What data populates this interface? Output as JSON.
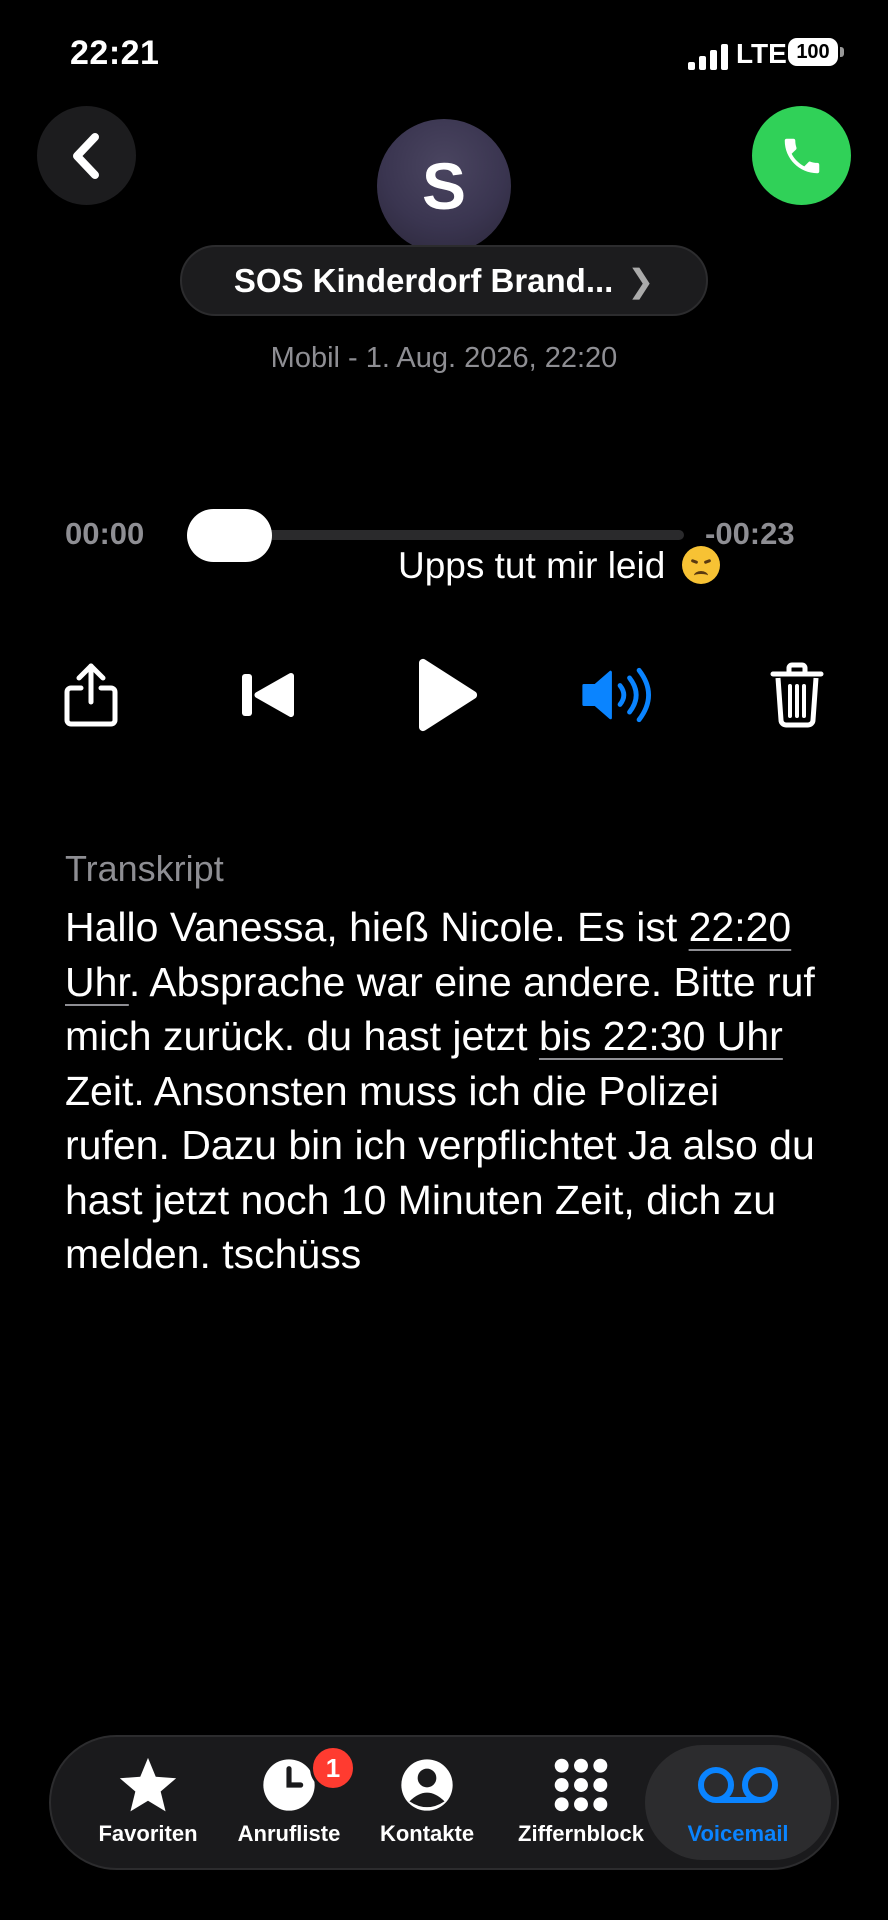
{
  "status_bar": {
    "time": "22:21",
    "network": "LTE",
    "battery": "100"
  },
  "contact": {
    "initial": "S",
    "name": "SOS Kinderdorf Brand...",
    "subline": "Mobil - 1. Aug. 2026, 22:20"
  },
  "player": {
    "current_time": "00:00",
    "remaining_time": "-00:23",
    "progress": 0
  },
  "overlay": {
    "text": "Upps tut mir leid"
  },
  "transcript": {
    "label": "Transkript",
    "parts": {
      "p1": "Hallo Vanessa, hieß Nicole. Es ist ",
      "link1": "22:20 Uhr",
      "p2": ". Absprache war eine andere. Bitte ruf mich zurück. du hast jetzt ",
      "link2": "bis 22:30 Uhr",
      "p3": " Zeit. Ansonsten muss ich die Polizei rufen. Dazu bin ich verpflichtet  Ja also du hast jetzt noch 10 Minuten Zeit, dich zu melden. tschüss"
    }
  },
  "tabs": [
    {
      "label": "Favoriten",
      "icon": "star-icon"
    },
    {
      "label": "Anrufliste",
      "icon": "clock-icon",
      "badge": "1"
    },
    {
      "label": "Kontakte",
      "icon": "person-circle-icon"
    },
    {
      "label": "Ziffernblock",
      "icon": "keypad-icon"
    },
    {
      "label": "Voicemail",
      "icon": "voicemail-icon",
      "active": true
    }
  ],
  "colors": {
    "accent": "#0a84ff",
    "call_green": "#30d158",
    "badge_red": "#ff3b30",
    "secondary_text": "#8e8e93"
  }
}
